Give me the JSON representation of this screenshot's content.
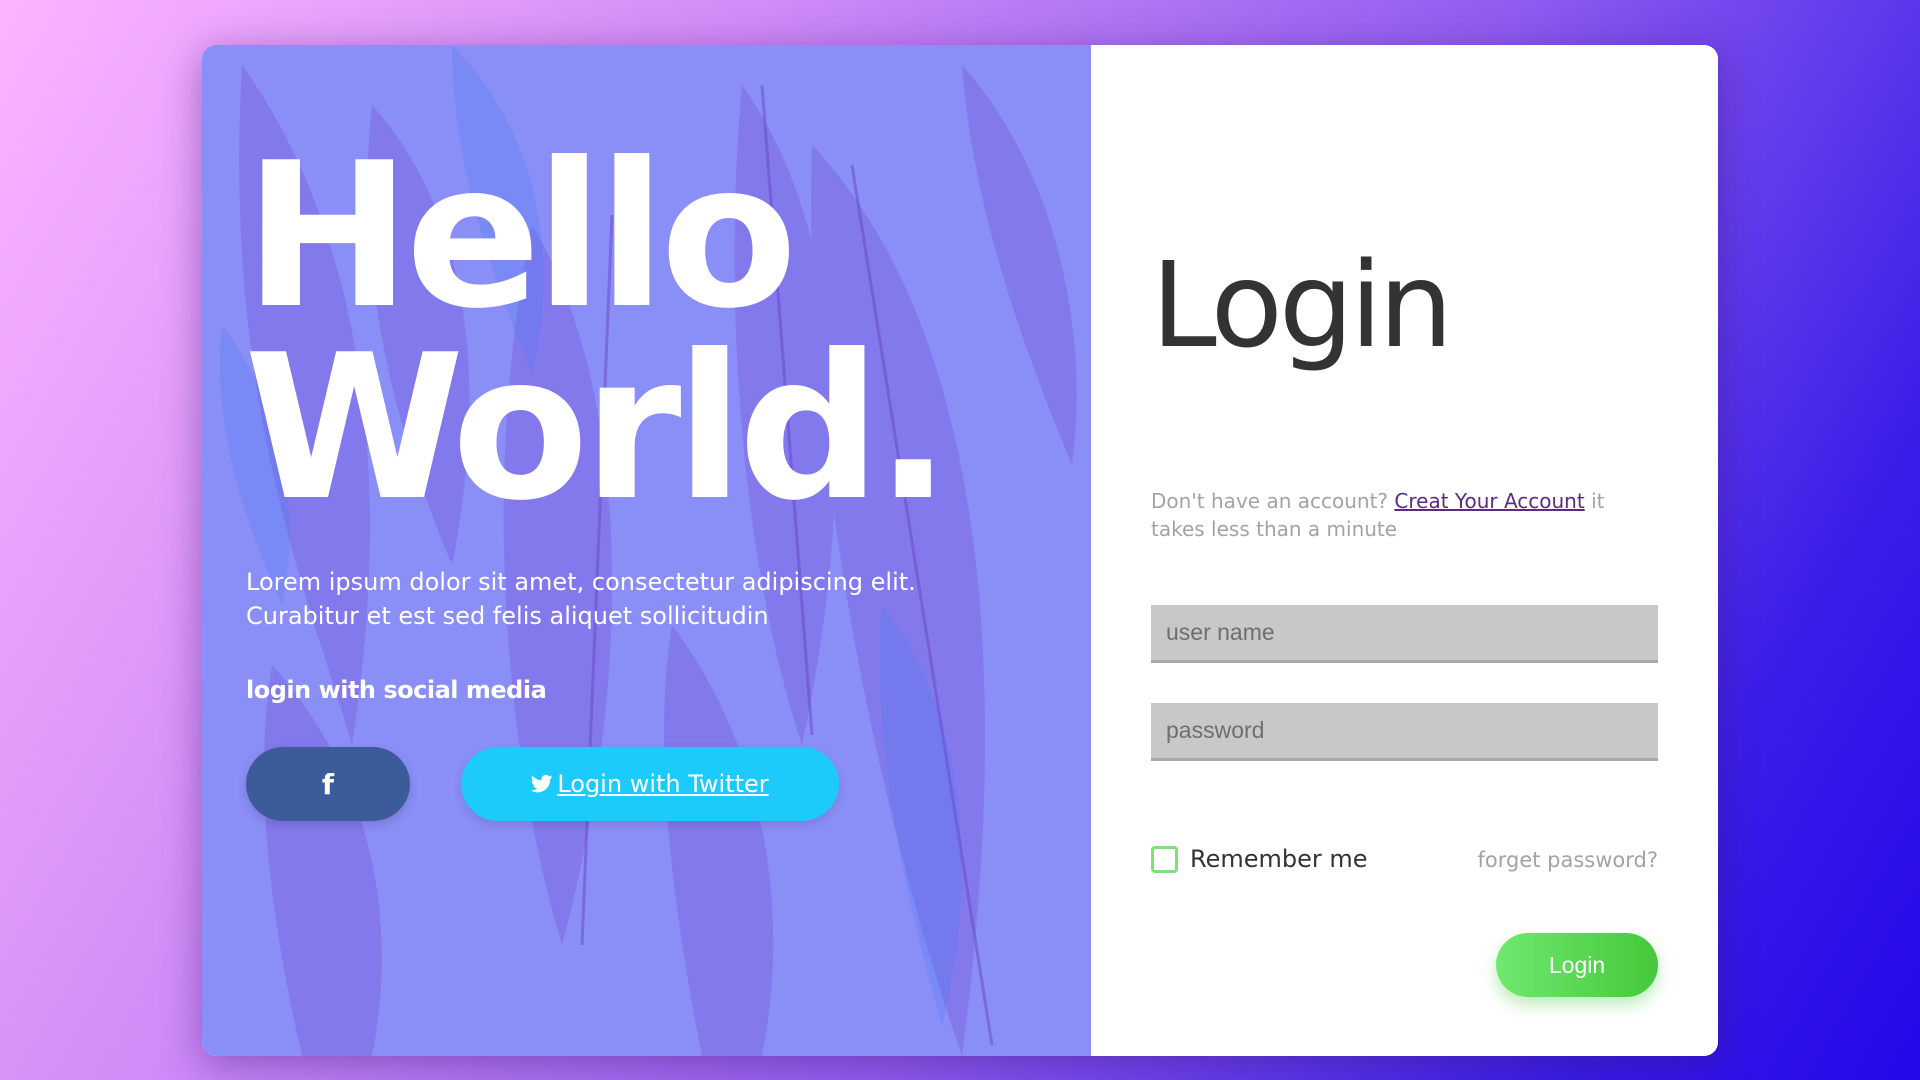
{
  "hero": {
    "title_line1": "Hello",
    "title_line2": "World.",
    "description": "Lorem ipsum dolor sit amet, consectetur adipiscing elit. Curabitur et est sed felis aliquet sollicitudin",
    "social_heading": "login with social media"
  },
  "social": {
    "facebook_label": "f",
    "twitter_label": "Login with Twitter"
  },
  "login": {
    "title": "Login",
    "signup_prefix": "Don't have an account?",
    "signup_link": "Creat Your Account",
    "signup_suffix": "it takes less than a minute",
    "username_placeholder": "user name",
    "password_placeholder": "password",
    "remember_label": "Remember me",
    "remember_checked": false,
    "forgot_label": "forget password?",
    "submit_label": "Login"
  },
  "colors": {
    "left_panel_tint": "#8a8ff7",
    "facebook": "#3b5b9a",
    "twitter": "#1ccbfb",
    "login_button": "#45c83b",
    "checkbox_border": "#7ee07e",
    "link": "#5b2a86"
  },
  "icons": {
    "facebook": "facebook-icon",
    "twitter": "twitter-bird-icon",
    "background": "feather-pattern"
  }
}
